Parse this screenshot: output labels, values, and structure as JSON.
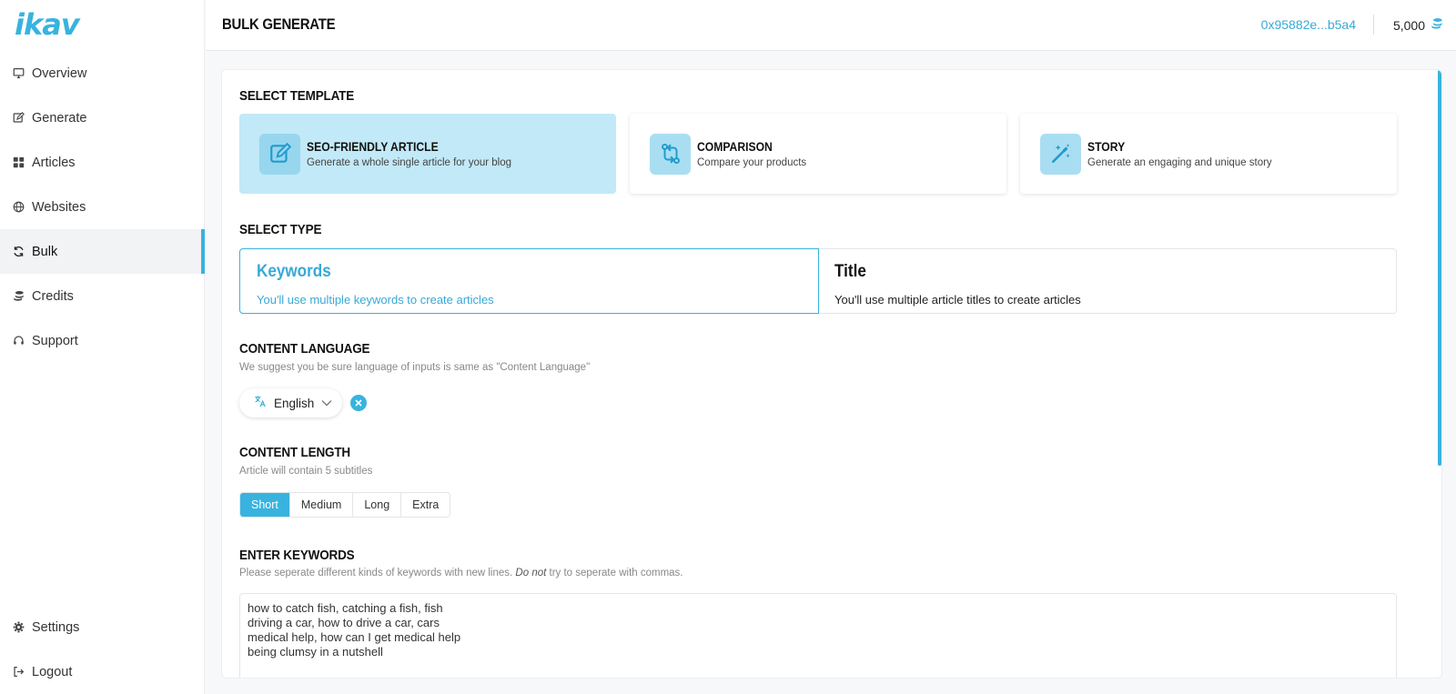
{
  "brand": {
    "logo": "ikav"
  },
  "sidebar": {
    "items": [
      {
        "label": "Overview",
        "icon": "monitor-icon"
      },
      {
        "label": "Generate",
        "icon": "edit-icon"
      },
      {
        "label": "Articles",
        "icon": "grid-icon"
      },
      {
        "label": "Websites",
        "icon": "globe-icon"
      },
      {
        "label": "Bulk",
        "icon": "refresh-icon",
        "active": true
      },
      {
        "label": "Credits",
        "icon": "coins-icon"
      },
      {
        "label": "Support",
        "icon": "headset-icon"
      }
    ],
    "bottom": [
      {
        "label": "Settings",
        "icon": "gear-icon"
      },
      {
        "label": "Logout",
        "icon": "logout-icon"
      }
    ]
  },
  "header": {
    "title": "BULK GENERATE",
    "wallet": "0x95882e...b5a4",
    "credits": "5,000"
  },
  "template_section": {
    "heading": "SELECT TEMPLATE",
    "templates": [
      {
        "title": "SEO-FRIENDLY ARTICLE",
        "desc": "Generate a whole single article for your blog",
        "icon": "edit-icon",
        "selected": true
      },
      {
        "title": "COMPARISON",
        "desc": "Compare your products",
        "icon": "compare-icon"
      },
      {
        "title": "STORY",
        "desc": "Generate an engaging and unique story",
        "icon": "magic-wand-icon"
      }
    ]
  },
  "type_section": {
    "heading": "SELECT TYPE",
    "options": [
      {
        "title": "Keywords",
        "desc": "You'll use multiple keywords to create articles",
        "selected": true
      },
      {
        "title": "Title",
        "desc": "You'll use multiple article titles to create articles"
      }
    ]
  },
  "language_section": {
    "heading": "CONTENT LANGUAGE",
    "sub": "We suggest you be sure language of inputs is same as \"Content Language\"",
    "selected": "English"
  },
  "length_section": {
    "heading": "CONTENT LENGTH",
    "sub": "Article will contain 5 subtitles",
    "options": [
      "Short",
      "Medium",
      "Long",
      "Extra"
    ],
    "selected": "Short"
  },
  "keywords_section": {
    "heading": "ENTER KEYWORDS",
    "sub_a": "Please seperate different kinds of keywords with new lines. ",
    "sub_em": "Do not",
    "sub_b": " try to seperate with commas.",
    "value": "how to catch fish, catching a fish, fish\ndriving a car, how to drive a car, cars\nmedical help, how can I get medical help\nbeing clumsy in a nutshell"
  },
  "colors": {
    "accent": "#38b3df",
    "selected_bg": "#c2e9f7"
  }
}
